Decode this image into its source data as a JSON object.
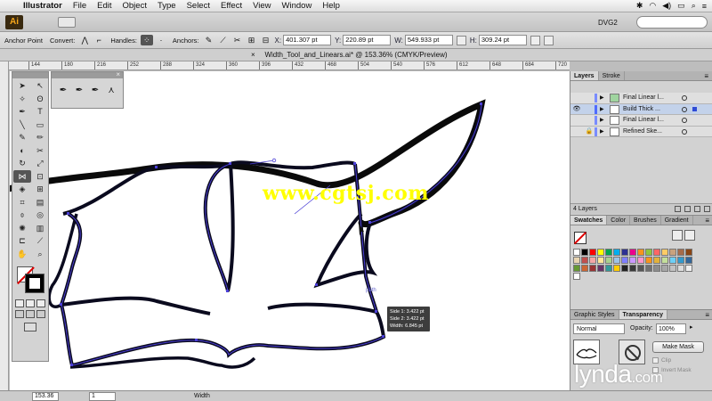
{
  "menubar": {
    "app_name": "Illustrator",
    "items": [
      "File",
      "Edit",
      "Object",
      "Type",
      "Select",
      "Effect",
      "View",
      "Window",
      "Help"
    ]
  },
  "appbar": {
    "logo": "Ai",
    "workspace": "DVG2"
  },
  "controlbar": {
    "tool_label": "Anchor Point",
    "convert_label": "Convert:",
    "handles_label": "Handles:",
    "anchors_label": "Anchors:",
    "x_label": "X:",
    "x_value": "401.307 pt",
    "y_label": "Y:",
    "y_value": "220.89 pt",
    "w_label": "W:",
    "w_value": "549.933 pt",
    "h_label": "H:",
    "h_value": "309.24 pt"
  },
  "document": {
    "tab_title": "Width_Tool_and_Linears.ai* @ 153.36% (CMYK/Preview)"
  },
  "ruler": {
    "ticks": [
      "144",
      "180",
      "216",
      "252",
      "288",
      "324",
      "360",
      "396",
      "432",
      "468",
      "504",
      "540",
      "576",
      "612",
      "648",
      "684",
      "720"
    ]
  },
  "canvas": {
    "watermark": "www.cgtsj.com",
    "path_hint": "path",
    "tooltip": {
      "side1": "Side 1: 3.422 pt",
      "side2": "Side 2: 3.422 pt",
      "width": "Width:  6.845 pt"
    }
  },
  "layers_panel": {
    "tab_layers": "Layers",
    "tab_stroke": "Stroke",
    "layers": [
      {
        "name": "Final Linear l...",
        "color": "#7a8cff"
      },
      {
        "name": "Build Thick ...",
        "color": "#4f6bff"
      },
      {
        "name": "Final Linear l...",
        "color": "#7a8cff"
      },
      {
        "name": "Refined Ske...",
        "color": "#7a8cff"
      }
    ],
    "count": "4 Layers"
  },
  "swatches_panel": {
    "tabs": [
      "Swatches",
      "Color",
      "Brushes",
      "Gradient"
    ],
    "colors": [
      "#ffffff",
      "#000000",
      "#ff0000",
      "#ffff00",
      "#00a651",
      "#00aeef",
      "#2e3192",
      "#ec008c",
      "#f7941d",
      "#8dc63f",
      "#ff6666",
      "#ffcc66",
      "#c9a27e",
      "#a66b4a",
      "#8b4513",
      "#e8d4b0",
      "#c0504d",
      "#f4a6a6",
      "#ffe699",
      "#a9d18e",
      "#9dc3e6",
      "#7f7fff",
      "#cc99ff",
      "#ff99cc",
      "#f7941d",
      "#e2b13c",
      "#c4df9b",
      "#6dcff6",
      "#3399cc",
      "#336699",
      "#669933",
      "#cc6633",
      "#993333",
      "#663366",
      "#339999",
      "#ffcc00",
      "#222222",
      "#3a3a3a",
      "#555555",
      "#707070",
      "#8c8c8c",
      "#a7a7a7",
      "#c2c2c2",
      "#dddddd",
      "#efefef",
      "#ffffff"
    ]
  },
  "transparency_panel": {
    "tab_graphic_styles": "Graphic Styles",
    "tab_transparency": "Transparency",
    "blend_mode": "Normal",
    "opacity_label": "Opacity:",
    "opacity_value": "100%",
    "make_mask": "Make Mask",
    "clip": "Clip",
    "invert_mask": "Invert Mask"
  },
  "statusbar": {
    "zoom": "153.36",
    "page": "1",
    "tool": "Width"
  },
  "branding": {
    "lynda": "lynda",
    "lynda_suffix": ".com"
  }
}
